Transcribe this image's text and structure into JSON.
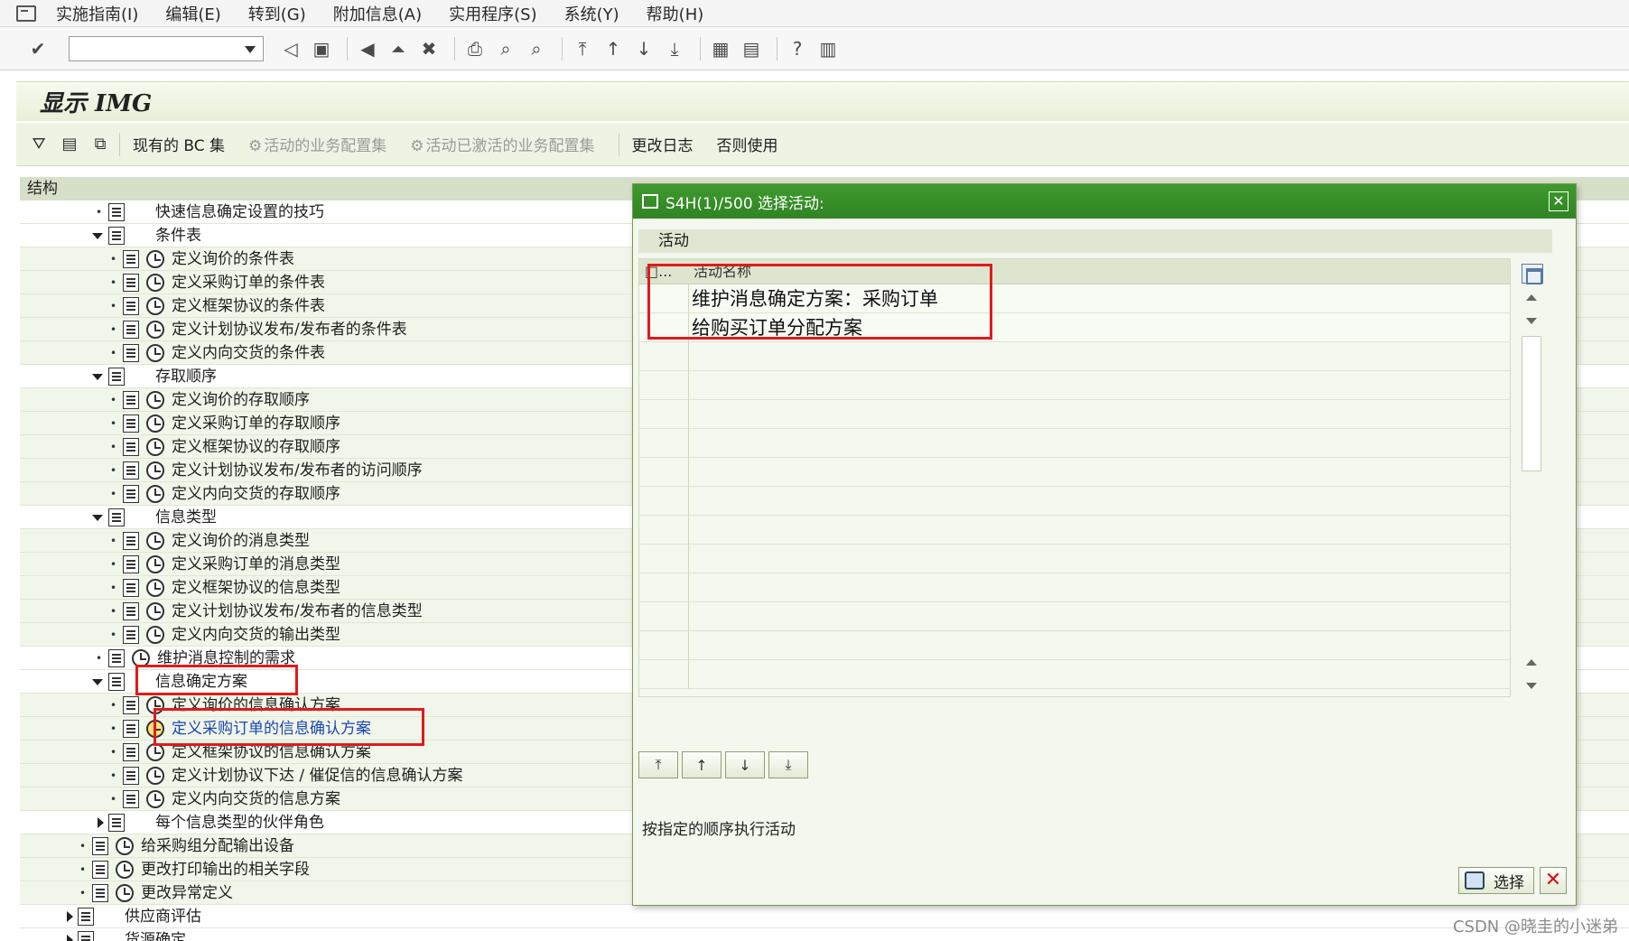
{
  "menubar": {
    "items": [
      "实施指南(I)",
      "编辑(E)",
      "转到(G)",
      "附加信息(A)",
      "实用程序(S)",
      "系统(Y)",
      "帮助(H)"
    ]
  },
  "page": {
    "title": "显示 IMG"
  },
  "apptoolbar": {
    "bc_set": "现有的 BC 集",
    "active_bc": "活动的业务配置集",
    "activated_bc": "活动已激活的业务配置集",
    "change_log": "更改日志",
    "otherwise_use": "否则使用"
  },
  "tree": {
    "header": "结构",
    "rows": [
      {
        "label": "快速信息确定设置的技巧"
      },
      {
        "label": "条件表"
      },
      {
        "label": "定义询价的条件表"
      },
      {
        "label": "定义采购订单的条件表"
      },
      {
        "label": "定义框架协议的条件表"
      },
      {
        "label": "定义计划协议发布/发布者的条件表"
      },
      {
        "label": "定义内向交货的条件表"
      },
      {
        "label": "存取顺序"
      },
      {
        "label": "定义询价的存取顺序"
      },
      {
        "label": "定义采购订单的存取顺序"
      },
      {
        "label": "定义框架协议的存取顺序"
      },
      {
        "label": "定义计划协议发布/发布者的访问顺序"
      },
      {
        "label": "定义内向交货的存取顺序"
      },
      {
        "label": "信息类型"
      },
      {
        "label": "定义询价的消息类型"
      },
      {
        "label": "定义采购订单的消息类型"
      },
      {
        "label": "定义框架协议的信息类型"
      },
      {
        "label": "定义计划协议发布/发布者的信息类型"
      },
      {
        "label": "定义内向交货的输出类型"
      },
      {
        "label": "维护消息控制的需求"
      },
      {
        "label": "信息确定方案"
      },
      {
        "label": "定义询价的信息确认方案"
      },
      {
        "label": "定义采购订单的信息确认方案"
      },
      {
        "label": "定义框架协议的信息确认方案"
      },
      {
        "label": "定义计划协议下达 / 催促信的信息确认方案"
      },
      {
        "label": "定义内向交货的信息方案"
      },
      {
        "label": "每个信息类型的伙伴角色"
      },
      {
        "label": "给采购组分配输出设备"
      },
      {
        "label": "更改打印输出的相关字段"
      },
      {
        "label": "更改异常定义"
      },
      {
        "label": "供应商评估"
      },
      {
        "label": "货源确定"
      }
    ]
  },
  "dialog": {
    "title": "S4H(1)/500 选择活动:",
    "section": "活动",
    "col1": "□...",
    "col2": "活动名称",
    "rows": [
      "维护消息确定方案：采购订单",
      "给购买订单分配方案"
    ],
    "hint": "按指定的顺序执行活动",
    "ok_label": "选择"
  },
  "watermark": "CSDN @晓圭的小迷弟"
}
